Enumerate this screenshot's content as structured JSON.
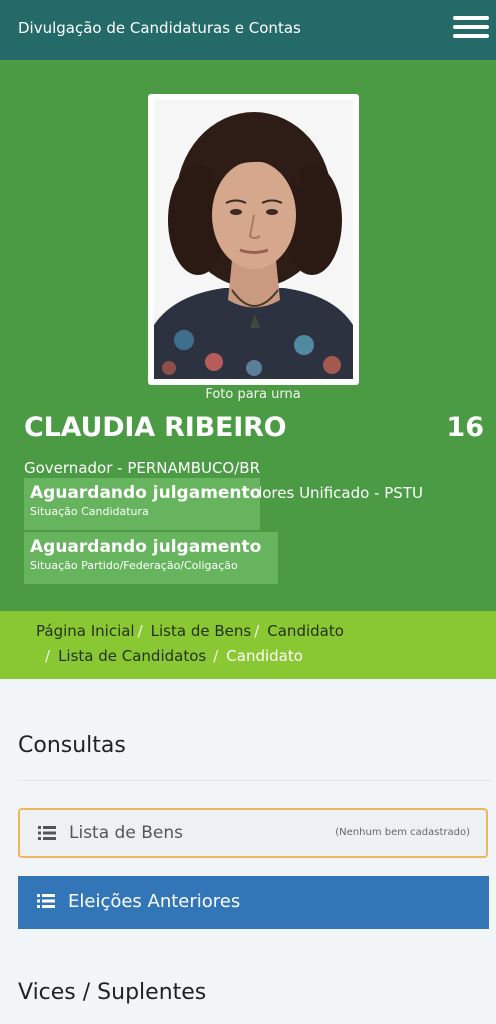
{
  "header": {
    "title": "Divulgação de Candidaturas e Contas",
    "menu_icon": "hamburger-menu-icon",
    "bg_color": "#236a68"
  },
  "candidate": {
    "photo_caption": "Foto para urna",
    "name": "CLAUDIA RIBEIRO",
    "number": "16",
    "office": "Governador - PERNAMBUCO/BR",
    "party": "Partido Socialista dos Trabalhadores Unificado - PSTU",
    "status_candidatura": {
      "value": "Aguardando julgamento",
      "label": "Situação Candidatura"
    },
    "status_partido": {
      "value": "Aguardando julgamento",
      "label": "Situação Partido/Federação/Coligação"
    },
    "hero_color": "#4b9b45"
  },
  "breadcrumb": {
    "items": [
      "Página Inicial",
      "Lista de Bens",
      "Candidato",
      "Lista de Candidatos",
      "Candidato"
    ],
    "separator": "/",
    "bg_color": "#8ac833"
  },
  "consultas": {
    "title": "Consultas",
    "lista_bens": {
      "icon": "list-icon",
      "label": "Lista de Bens",
      "note": "(Nenhum bem cadastrado)"
    },
    "eleicoes_anteriores": {
      "icon": "list-icon",
      "label": "Eleições Anteriores",
      "color": "#3276b8"
    }
  },
  "vices": {
    "title": "Vices / Suplentes"
  }
}
